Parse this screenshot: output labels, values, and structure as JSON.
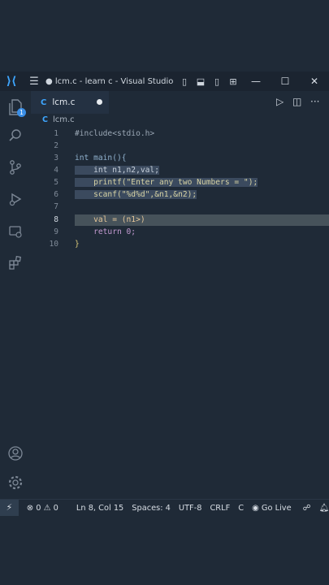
{
  "titlebar": {
    "title": "● lcm.c - learn c - Visual Studio ...",
    "minimize": "—",
    "maximize": "☐",
    "close": "✕"
  },
  "activity": {
    "explorer_badge": "1"
  },
  "tab": {
    "lang": "C",
    "filename": "lcm.c"
  },
  "breadcrumb": {
    "lang": "C",
    "filename": "lcm.c"
  },
  "editor": {
    "line_numbers": [
      "1",
      "2",
      "3",
      "4",
      "5",
      "6",
      "7",
      "8",
      "9",
      "10"
    ],
    "lines": [
      "#include<stdio.h>",
      "",
      "int main(){",
      "    int n1,n2,val;",
      "    printf(\"Enter any two Numbers = \");",
      "    scanf(\"%d%d\",&n1,&n2);",
      "",
      "    val = (n1>)",
      "    return 0;",
      "}"
    ]
  },
  "status": {
    "remote": "⚡",
    "errors": "0",
    "warnings": "0",
    "position": "Ln 8, Col 15",
    "spaces": "Spaces: 4",
    "encoding": "UTF-8",
    "eol": "CRLF",
    "language": "C",
    "golive": "Go Live"
  }
}
